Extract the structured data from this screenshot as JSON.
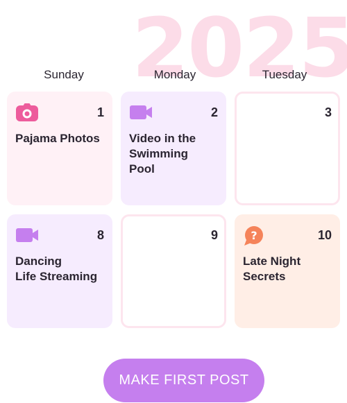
{
  "year": "2025",
  "days": [
    "Sunday",
    "Monday",
    "Tuesday"
  ],
  "cards": [
    {
      "number": "1",
      "title": "Pajama Photos",
      "icon": "camera-icon",
      "color": "#fff1f6",
      "icon_color": "#ed5c9c"
    },
    {
      "number": "2",
      "title": "Video in the\nSwimming\nPool",
      "icon": "video-camera-icon",
      "color": "#f6ecfe",
      "icon_color": "#c57fee"
    },
    {
      "number": "3",
      "title": "",
      "icon": "",
      "color": "#ffffff"
    },
    {
      "number": "8",
      "title": "Dancing\nLife Streaming",
      "icon": "video-camera-icon",
      "color": "#f6ecfe",
      "icon_color": "#c57fee"
    },
    {
      "number": "9",
      "title": "",
      "icon": "",
      "color": "#ffffff"
    },
    {
      "number": "10",
      "title": "Late Night\nSecrets",
      "icon": "question-chat-icon",
      "color": "#ffeee6",
      "icon_color": "#f5835a"
    }
  ],
  "cta": {
    "label": "MAKE FIRST POST"
  },
  "colors": {
    "accent": "#c57fee",
    "year_watermark": "#fcdce8",
    "empty_border": "#fde5ee"
  }
}
